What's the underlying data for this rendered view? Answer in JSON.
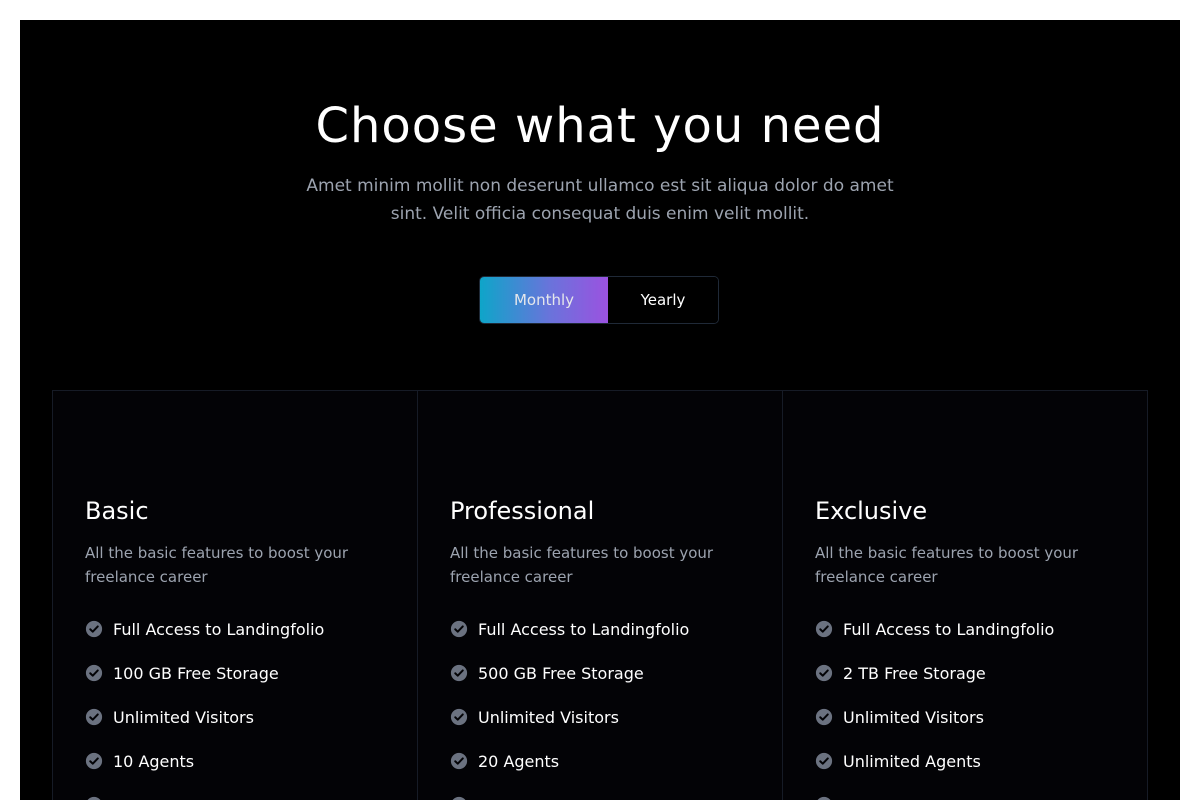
{
  "hero": {
    "title": "Choose what you need",
    "subtitle": "Amet minim mollit non deserunt ullamco est sit aliqua dolor do amet sint. Velit officia consequat duis enim velit mollit."
  },
  "billing_toggle": {
    "options": [
      "Monthly",
      "Yearly"
    ],
    "selected": "Monthly"
  },
  "colors": {
    "background": "#000000",
    "accent_gradient_start": "#0ea5c9",
    "accent_gradient_end": "#9b52e0",
    "muted_text": "#9ca3af",
    "check_icon": "#6b7280"
  },
  "plans": [
    {
      "name": "Basic",
      "description": "All the basic features to boost your freelance career",
      "features": [
        "Full Access to Landingfolio",
        "100 GB Free Storage",
        "Unlimited Visitors",
        "10 Agents"
      ]
    },
    {
      "name": "Professional",
      "description": "All the basic features to boost your freelance career",
      "features": [
        "Full Access to Landingfolio",
        "500 GB Free Storage",
        "Unlimited Visitors",
        "20 Agents"
      ]
    },
    {
      "name": "Exclusive",
      "description": "All the basic features to boost your freelance career",
      "features": [
        "Full Access to Landingfolio",
        "2 TB Free Storage",
        "Unlimited Visitors",
        "Unlimited Agents"
      ]
    }
  ],
  "icons": {
    "feature_bullet": "check-circle-icon"
  }
}
